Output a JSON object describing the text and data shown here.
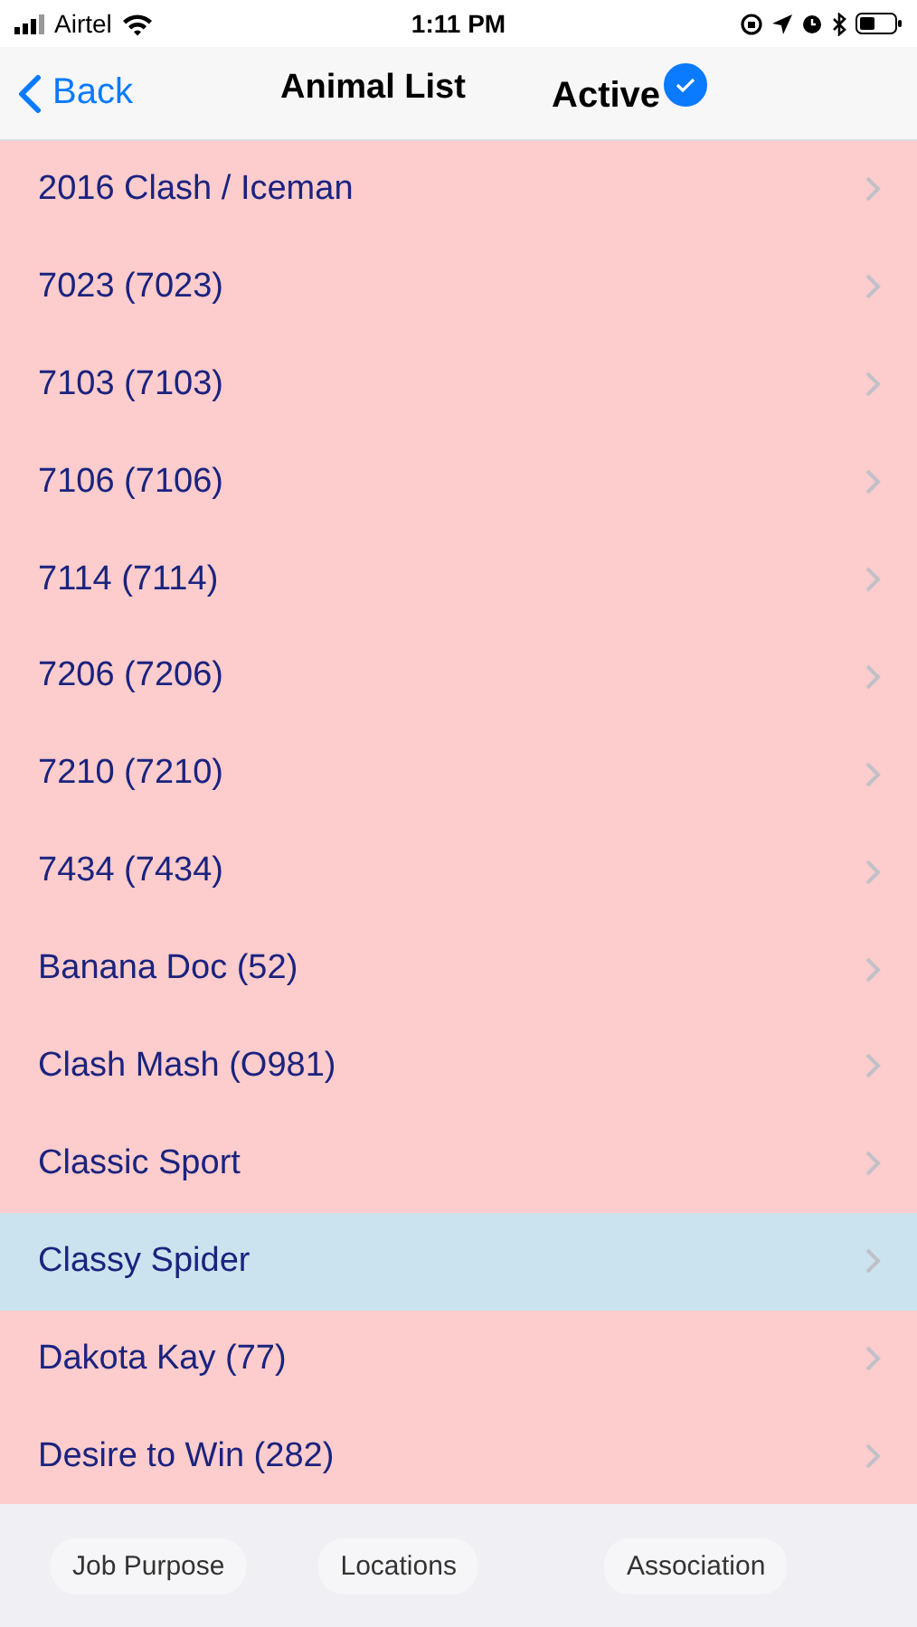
{
  "status_bar": {
    "carrier": "Airtel",
    "time": "1:11 PM"
  },
  "nav_bar": {
    "back": "Back",
    "title": "Animal List",
    "active": {
      "label": "Active",
      "checked": true
    }
  },
  "animals": [
    {
      "name": "2016 Clash / Iceman",
      "selected": false
    },
    {
      "name": "7023 (7023)",
      "selected": false
    },
    {
      "name": "7103 (7103)",
      "selected": false
    },
    {
      "name": "7106 (7106)",
      "selected": false
    },
    {
      "name": "7114 (7114)",
      "selected": false
    },
    {
      "name": "7206 (7206)",
      "selected": false
    },
    {
      "name": "7210 (7210)",
      "selected": false
    },
    {
      "name": "7434 (7434)",
      "selected": false
    },
    {
      "name": "Banana Doc (52)",
      "selected": false
    },
    {
      "name": "Clash Mash (O981)",
      "selected": false
    },
    {
      "name": "Classic Sport",
      "selected": false
    },
    {
      "name": "Classy Spider",
      "selected": true
    },
    {
      "name": "Dakota Kay (77)",
      "selected": false
    },
    {
      "name": "Desire to Win (282)",
      "selected": false
    }
  ],
  "bottom_buttons": [
    "Job Purpose",
    "Locations",
    "Association"
  ]
}
